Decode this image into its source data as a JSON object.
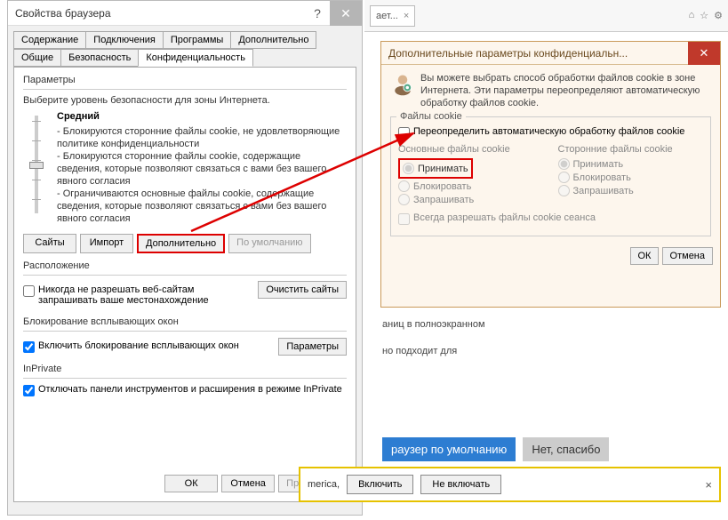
{
  "dialog1": {
    "title": "Свойства браузера",
    "tabs_row1": [
      "Содержание",
      "Подключения",
      "Программы",
      "Дополнительно"
    ],
    "tabs_row2": [
      "Общие",
      "Безопасность",
      "Конфиденциальность"
    ],
    "active_tab": "Конфиденциальность",
    "params_label": "Параметры",
    "instr": "Выберите уровень безопасности для зоны Интернета.",
    "level": "Средний",
    "policy_lines": [
      "- Блокируются сторонние файлы cookie, не удовлетворяющие политике конфиденциальности",
      "- Блокируются сторонние файлы cookie, содержащие сведения, которые позволяют связаться с вами без вашего явного согласия",
      "- Ограничиваются основные файлы cookie, содержащие сведения, которые позволяют связаться с вами без вашего явного согласия"
    ],
    "btn_sites": "Сайты",
    "btn_import": "Импорт",
    "btn_advanced": "Дополнительно",
    "btn_default": "По умолчанию",
    "loc_label": "Расположение",
    "loc_checkbox": "Никогда не разрешать веб-сайтам запрашивать ваше местонахождение",
    "btn_clear_sites": "Очистить сайты",
    "popup_label": "Блокирование всплывающих окон",
    "popup_checkbox": "Включить блокирование всплывающих окон",
    "btn_popup_params": "Параметры",
    "inprivate_label": "InPrivate",
    "inprivate_checkbox": "Отключать панели инструментов и расширения в режиме InPrivate",
    "btn_ok": "ОК",
    "btn_cancel": "Отмена",
    "btn_apply": "Применить"
  },
  "dialog2": {
    "title": "Дополнительные параметры конфиденциальн...",
    "info": "Вы можете выбрать способ обработки файлов cookie в зоне Интернета. Эти параметры переопределяют автоматическую обработку файлов cookie.",
    "cookies_label": "Файлы cookie",
    "override_checkbox": "Переопределить автоматическую обработку файлов cookie",
    "col1_head": "Основные файлы cookie",
    "col2_head": "Сторонние файлы cookie",
    "opt_accept": "Принимать",
    "opt_block": "Блокировать",
    "opt_prompt": "Запрашивать",
    "session_checkbox": "Всегда разрешать файлы cookie сеанса",
    "btn_ok": "ОК",
    "btn_cancel": "Отмена"
  },
  "bg": {
    "tab_label": "ает...",
    "text1": "аниц в полноэкранном",
    "text2": "но подходит для",
    "blue_btn": "раузер по умолчанию",
    "grey_btn": "Нет, спасибо",
    "yellow_text": "merica,",
    "yb_on": "Включить",
    "yb_off": "Не включать"
  }
}
